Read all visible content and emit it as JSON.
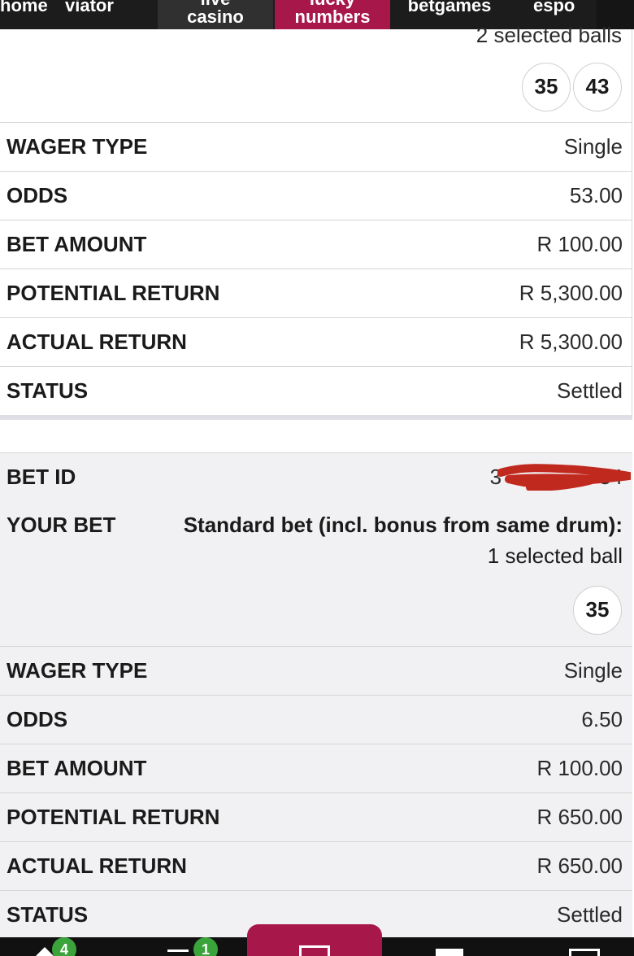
{
  "nav": {
    "items": [
      {
        "label": "home"
      },
      {
        "label": "viator"
      },
      {
        "label1": "live",
        "label2": "casino"
      },
      {
        "label1": "lucky",
        "label2": "numbers"
      },
      {
        "label": "betgames"
      },
      {
        "label": "espo"
      }
    ]
  },
  "bet1": {
    "selected_text": "2 selected balls",
    "balls": [
      "35",
      "43"
    ],
    "rows": [
      {
        "label": "WAGER TYPE",
        "value": "Single"
      },
      {
        "label": "ODDS",
        "value": "53.00"
      },
      {
        "label": "BET AMOUNT",
        "value": "R 100.00"
      },
      {
        "label": "POTENTIAL RETURN",
        "value": "R 5,300.00"
      },
      {
        "label": "ACTUAL RETURN",
        "value": "R 5,300.00"
      },
      {
        "label": "STATUS",
        "value": "Settled"
      }
    ]
  },
  "bet2": {
    "bet_id_label": "BET ID",
    "bet_id_value": "3",
    "bet_id_tail": "54",
    "your_bet_label": "YOUR BET",
    "your_bet_desc": "Standard bet (incl. bonus from same drum):",
    "selected_text": "1 selected ball",
    "balls": [
      "35"
    ],
    "rows": [
      {
        "label": "WAGER TYPE",
        "value": "Single"
      },
      {
        "label": "ODDS",
        "value": "6.50"
      },
      {
        "label": "BET AMOUNT",
        "value": "R 100.00"
      },
      {
        "label": "POTENTIAL RETURN",
        "value": "R 650.00"
      },
      {
        "label": "ACTUAL RETURN",
        "value": "R 650.00"
      },
      {
        "label": "STATUS",
        "value": "Settled"
      }
    ]
  },
  "bottom": {
    "home_badge": "4",
    "bets_badge": "1"
  },
  "colors": {
    "brand": "#a8174a",
    "badge": "#3aa33a",
    "redaction": "#c0291e"
  }
}
